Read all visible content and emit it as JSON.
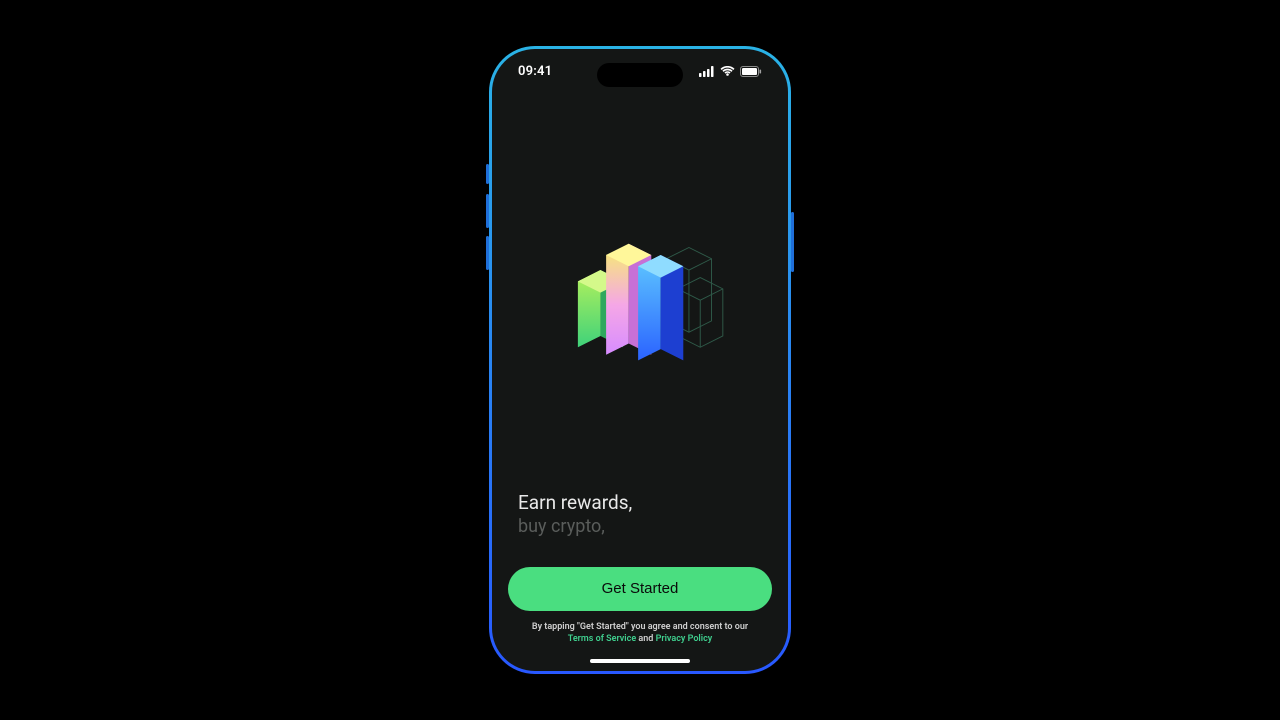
{
  "status": {
    "time": "09:41"
  },
  "hero": {
    "icon_name": "isometric-bars-icon"
  },
  "tagline": {
    "line1": "Earn rewards,",
    "line2": "buy crypto,"
  },
  "cta": {
    "label": "Get Started"
  },
  "legal": {
    "prefix": "By tapping \"Get Started\" you agree and consent to our",
    "terms": "Terms of Service",
    "and": " and ",
    "privacy": "Privacy Policy"
  },
  "colors": {
    "accent": "#4ade80",
    "link": "#3fcf8e"
  }
}
